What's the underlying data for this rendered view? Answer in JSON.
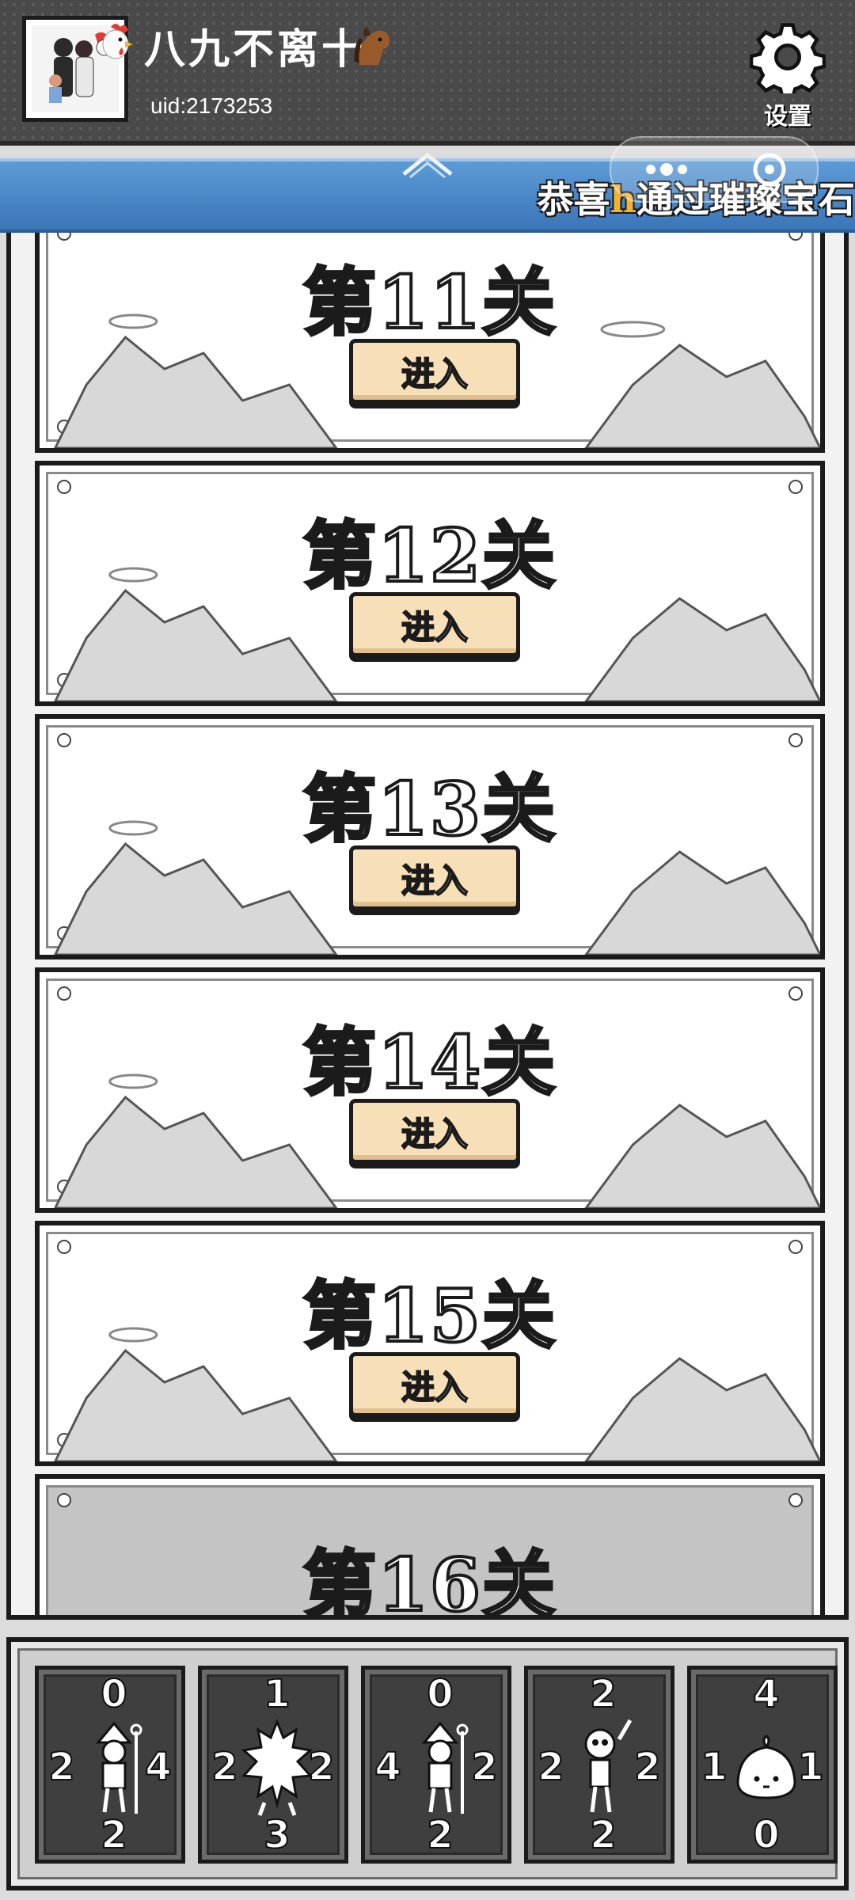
{
  "header": {
    "player_name": "八九不离十",
    "name_emojis": [
      "🐔",
      "🐴"
    ],
    "uid": "uid:2173253",
    "settings_label": "设置"
  },
  "marquee": {
    "prefix": "恭喜",
    "highlight": "h",
    "suffix": "通过璀璨宝石",
    "highlight_color": "#f2b233"
  },
  "levels": [
    {
      "title": "第11关",
      "button": "进入"
    },
    {
      "title": "第12关",
      "button": "进入"
    },
    {
      "title": "第13关",
      "button": "进入"
    },
    {
      "title": "第14关",
      "button": "进入"
    },
    {
      "title": "第15关",
      "button": "进入"
    },
    {
      "title": "第16关",
      "locked": true
    }
  ],
  "cards": [
    {
      "unit": "archer-icon",
      "top": "0",
      "left": "2",
      "right": "4",
      "bottom": "2"
    },
    {
      "unit": "spiky-blob-icon",
      "top": "1",
      "left": "2",
      "right": "2",
      "bottom": "3"
    },
    {
      "unit": "archer-icon",
      "top": "0",
      "left": "4",
      "right": "2",
      "bottom": "2"
    },
    {
      "unit": "skeleton-icon",
      "top": "2",
      "left": "2",
      "right": "2",
      "bottom": "2"
    },
    {
      "unit": "slime-icon",
      "top": "4",
      "left": "1",
      "right": "1",
      "bottom": "0"
    }
  ],
  "colors": {
    "header_bg": "#4a4a4a",
    "marquee_bg": "#4a86c6",
    "button_bg": "#f7dfb8",
    "card_bg": "#3f3f3f"
  }
}
